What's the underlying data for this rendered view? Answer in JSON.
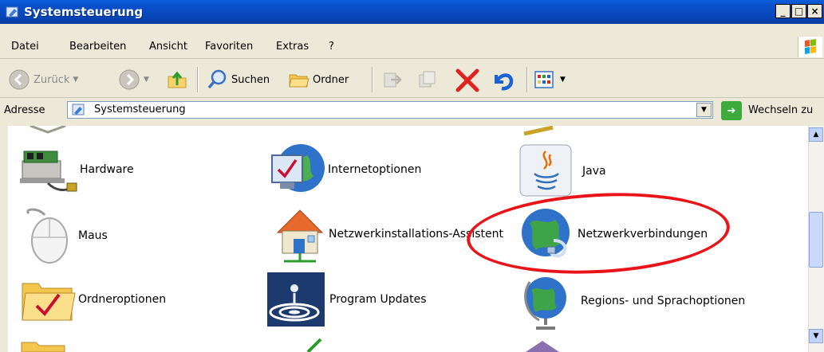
{
  "window": {
    "title": "Systemsteuerung"
  },
  "menu": {
    "items": [
      {
        "label": "Datei"
      },
      {
        "label": "Bearbeiten"
      },
      {
        "label": "Ansicht"
      },
      {
        "label": "Favoriten"
      },
      {
        "label": "Extras"
      },
      {
        "label": "?"
      }
    ]
  },
  "toolbar": {
    "back_label": "Zurück",
    "search_label": "Suchen",
    "folders_label": "Ordner"
  },
  "address": {
    "label": "Adresse",
    "value": "Systemsteuerung",
    "go_label": "Wechseln zu"
  },
  "items": [
    {
      "label": "Hardware",
      "icon": "hardware-icon"
    },
    {
      "label": "Internetoptionen",
      "icon": "internet-options-icon"
    },
    {
      "label": "Java",
      "icon": "java-icon"
    },
    {
      "label": "Maus",
      "icon": "mouse-icon"
    },
    {
      "label": "Netzwerkinstallations-Assistent",
      "icon": "network-setup-icon"
    },
    {
      "label": "Netzwerkverbindungen",
      "icon": "network-connections-icon"
    },
    {
      "label": "Ordneroptionen",
      "icon": "folder-options-icon"
    },
    {
      "label": "Program Updates",
      "icon": "program-updates-icon"
    },
    {
      "label": "Regions- und Sprachoptionen",
      "icon": "regional-options-icon"
    }
  ],
  "colors": {
    "title_bar": "#0a4ec9",
    "highlight_ellipse": "#e8141a"
  }
}
